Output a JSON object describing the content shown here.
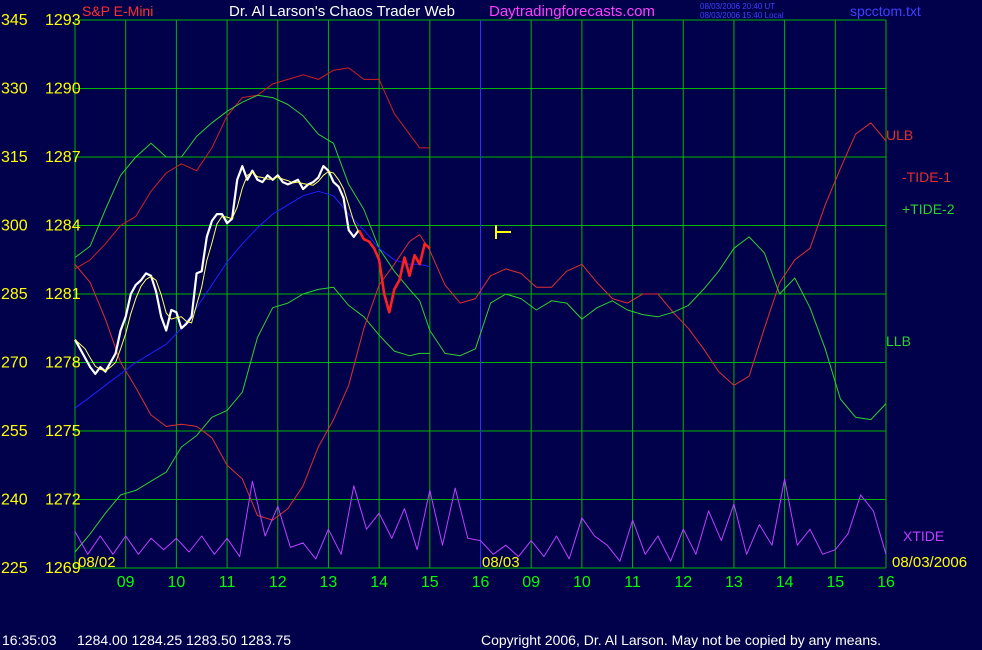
{
  "header": {
    "instrument": "S&P E-Mini",
    "title": "Dr. Al Larson's Chaos Trader Web",
    "site": "Daytradingforecasts.com",
    "timestamp_ut": "08/03/2006 20:40 UT",
    "timestamp_local": "08/03/2006 15:40 Local",
    "filename": "spcctom.txt"
  },
  "status_bar": {
    "time": "16:35:03",
    "quote": "1284.00 1284.25 1283.50 1283.75",
    "copyright": "Copyright 2006, Dr. Al Larson. May not be copied by any means."
  },
  "colors": {
    "background": "#00004b",
    "grid": "#00b400",
    "ulb": "#d22020",
    "tide1": "#e03030",
    "tide2": "#30d030",
    "xtide": "#c040ff",
    "blue": "#2020ff",
    "price": "#ffffff",
    "price_now": "#ff2020",
    "axis_left": "#ffff00",
    "axis_bottom": "#00ff00"
  },
  "chart_data": {
    "type": "line",
    "title": "S&P E-Mini",
    "y_left_labels": [
      "345",
      "330",
      "315",
      "300",
      "285",
      "270",
      "255",
      "240",
      "225"
    ],
    "y_price_labels": [
      "1293",
      "1290",
      "1287",
      "1284",
      "1281",
      "1278",
      "1275",
      "1272",
      "1269"
    ],
    "ylim": [
      1269,
      1293
    ],
    "x_hours_day1": [
      "09",
      "10",
      "11",
      "12",
      "13",
      "14",
      "15",
      "16"
    ],
    "x_hours_day2": [
      "09",
      "10",
      "11",
      "12",
      "13",
      "14",
      "15",
      "16"
    ],
    "x_grid_count": 16,
    "date_labels": [
      "08/02",
      "08/03",
      "08/03/2006"
    ],
    "grid": true,
    "legend_labels": {
      "ulb": "ULB",
      "tide1": "-TIDE-1",
      "tide2": "+TIDE-2",
      "llb": "LLB",
      "xtide": "XTIDE"
    },
    "series": [
      {
        "name": "ULB",
        "x": [
          0,
          0.3,
          0.6,
          0.9,
          1.2,
          1.5,
          1.8,
          2.1,
          2.4,
          2.7,
          3.0,
          3.3,
          3.6,
          3.9,
          4.2,
          4.5,
          4.8,
          5.1,
          5.4,
          5.7,
          6.0,
          6.3,
          6.6,
          6.8,
          7.0
        ],
        "y": [
          1282.1,
          1282.5,
          1283.2,
          1284.0,
          1284.4,
          1285.5,
          1286.3,
          1286.7,
          1286.4,
          1287.4,
          1288.8,
          1289.6,
          1289.7,
          1290.2,
          1290.4,
          1290.6,
          1290.4,
          1290.8,
          1290.9,
          1290.4,
          1290.4,
          1288.9,
          1288.0,
          1287.4,
          1287.4
        ]
      },
      {
        "name": "LLB",
        "x": [
          0,
          0.3,
          0.6,
          0.9,
          1.2,
          1.5,
          1.8,
          2.1,
          2.4,
          2.7,
          3.0,
          3.3,
          3.6,
          3.9,
          4.2,
          4.5,
          4.8,
          5.1,
          5.4,
          5.7,
          6.0,
          6.3,
          6.6,
          6.8,
          7.0
        ],
        "y": [
          1269.7,
          1270.5,
          1271.4,
          1272.2,
          1272.4,
          1272.8,
          1273.2,
          1274.3,
          1274.8,
          1275.6,
          1275.9,
          1276.7,
          1279.1,
          1280.4,
          1280.6,
          1281.0,
          1281.2,
          1281.3,
          1280.5,
          1280.0,
          1279.2,
          1278.5,
          1278.3,
          1278.4,
          1278.4
        ]
      },
      {
        "name": "-TIDE-1",
        "x": [
          0,
          0.3,
          0.6,
          0.9,
          1.2,
          1.5,
          1.8,
          2.1,
          2.4,
          2.7,
          3.0,
          3.3,
          3.6,
          3.9,
          4.2,
          4.5,
          4.8,
          5.1,
          5.4,
          5.7,
          6.0,
          6.3,
          6.6,
          6.8,
          7.0,
          7.3,
          7.6,
          7.9,
          8.2,
          8.5,
          8.8,
          9.1,
          9.4,
          9.7,
          10.0,
          10.3,
          10.6,
          10.9,
          11.2,
          11.5,
          11.8,
          12.1,
          12.4,
          12.7,
          13.0,
          13.3,
          13.6,
          13.9,
          14.2,
          14.5,
          14.8,
          15.1,
          15.4,
          15.7,
          16.0
        ],
        "y": [
          1282.3,
          1281.5,
          1279.9,
          1278.0,
          1276.9,
          1275.7,
          1275.2,
          1275.3,
          1275.2,
          1274.7,
          1273.5,
          1272.9,
          1271.3,
          1271.1,
          1271.6,
          1272.6,
          1274.3,
          1275.5,
          1277.0,
          1279.5,
          1281.4,
          1282.3,
          1283.3,
          1283.6,
          1282.9,
          1281.4,
          1280.6,
          1280.8,
          1281.8,
          1282.1,
          1281.9,
          1281.3,
          1281.3,
          1282.0,
          1282.3,
          1281.5,
          1280.8,
          1280.6,
          1281.0,
          1281.0,
          1280.2,
          1279.5,
          1278.6,
          1277.6,
          1277.0,
          1277.4,
          1279.5,
          1281.5,
          1282.5,
          1283.0,
          1284.9,
          1286.5,
          1288.0,
          1288.5,
          1287.7
        ]
      },
      {
        "name": "+TIDE-2",
        "x": [
          0,
          0.3,
          0.6,
          0.9,
          1.2,
          1.5,
          1.8,
          2.1,
          2.4,
          2.7,
          3.0,
          3.3,
          3.6,
          3.9,
          4.2,
          4.5,
          4.8,
          5.1,
          5.4,
          5.7,
          6.0,
          6.3,
          6.6,
          6.8,
          7.0,
          7.3,
          7.6,
          7.9,
          8.2,
          8.5,
          8.8,
          9.1,
          9.4,
          9.7,
          10.0,
          10.3,
          10.6,
          10.9,
          11.2,
          11.5,
          11.8,
          12.1,
          12.4,
          12.7,
          13.0,
          13.3,
          13.6,
          13.9,
          14.2,
          14.5,
          14.8,
          15.1,
          15.4,
          15.7,
          16.0
        ],
        "y": [
          1282.6,
          1283.1,
          1284.7,
          1286.2,
          1287.0,
          1287.6,
          1287.0,
          1287.0,
          1287.9,
          1288.5,
          1289.0,
          1289.4,
          1289.7,
          1289.6,
          1289.3,
          1288.8,
          1288.0,
          1287.6,
          1285.8,
          1284.7,
          1283.0,
          1282.0,
          1281.2,
          1280.7,
          1279.4,
          1278.4,
          1278.3,
          1278.6,
          1280.6,
          1281.0,
          1280.8,
          1280.3,
          1280.7,
          1280.6,
          1279.9,
          1280.4,
          1280.7,
          1280.3,
          1280.1,
          1280.0,
          1280.2,
          1280.5,
          1281.2,
          1282.0,
          1283.0,
          1283.5,
          1282.8,
          1281.0,
          1281.7,
          1280.4,
          1278.6,
          1276.4,
          1275.6,
          1275.5,
          1276.2
        ]
      },
      {
        "name": "blue",
        "x": [
          0,
          0.3,
          0.6,
          0.9,
          1.2,
          1.5,
          1.8,
          2.1,
          2.4,
          2.7,
          3.0,
          3.3,
          3.6,
          3.9,
          4.2,
          4.5,
          4.8,
          5.1,
          5.4,
          5.7,
          6.0,
          6.3,
          6.6,
          6.8,
          7.0
        ],
        "y": [
          1276.0,
          1276.5,
          1277.0,
          1277.5,
          1278.0,
          1278.4,
          1278.8,
          1279.5,
          1280.4,
          1281.4,
          1282.4,
          1283.2,
          1283.9,
          1284.5,
          1284.9,
          1285.3,
          1285.5,
          1285.3,
          1284.5,
          1283.8,
          1283.0,
          1282.5,
          1282.3,
          1282.3,
          1282.2
        ]
      },
      {
        "name": "price",
        "x": [
          0,
          0.1,
          0.2,
          0.3,
          0.4,
          0.5,
          0.6,
          0.7,
          0.8,
          0.9,
          1.0,
          1.1,
          1.2,
          1.3,
          1.4,
          1.5,
          1.6,
          1.7,
          1.8,
          1.9,
          2.0,
          2.1,
          2.2,
          2.3,
          2.4,
          2.5,
          2.6,
          2.7,
          2.8,
          2.9,
          3.0,
          3.1,
          3.2,
          3.3,
          3.4,
          3.5,
          3.6,
          3.7,
          3.8,
          3.9,
          4.0,
          4.1,
          4.2,
          4.3,
          4.4,
          4.5,
          4.6,
          4.7,
          4.8,
          4.9,
          5.0,
          5.1,
          5.2,
          5.3,
          5.4,
          5.5,
          5.6
        ],
        "y": [
          1279.0,
          1278.6,
          1278.2,
          1277.8,
          1277.5,
          1277.8,
          1277.6,
          1278.0,
          1278.4,
          1279.4,
          1280.0,
          1281.0,
          1281.4,
          1281.6,
          1281.9,
          1281.8,
          1281.1,
          1280.0,
          1279.4,
          1280.3,
          1280.2,
          1279.5,
          1279.7,
          1280.0,
          1281.9,
          1282.0,
          1283.5,
          1284.2,
          1284.5,
          1284.5,
          1284.1,
          1284.3,
          1286.0,
          1286.6,
          1286.0,
          1286.4,
          1286.0,
          1285.9,
          1286.2,
          1286.0,
          1286.2,
          1285.9,
          1285.8,
          1285.9,
          1286.0,
          1285.6,
          1285.8,
          1285.9,
          1286.1,
          1286.6,
          1286.4,
          1285.9,
          1285.7,
          1285.2,
          1283.8,
          1283.5,
          1283.8
        ]
      },
      {
        "name": "price_now",
        "x": [
          5.6,
          5.7,
          5.8,
          5.9,
          6.0,
          6.1,
          6.2,
          6.3,
          6.4,
          6.5,
          6.6,
          6.7,
          6.8,
          6.9,
          7.0
        ],
        "y": [
          1283.8,
          1283.4,
          1283.3,
          1283.0,
          1282.5,
          1281.0,
          1280.2,
          1281.2,
          1281.6,
          1282.6,
          1281.8,
          1282.7,
          1282.3,
          1283.2,
          1283.0
        ]
      },
      {
        "name": "XTIDE",
        "x": [
          0,
          0.25,
          0.5,
          0.75,
          1.0,
          1.25,
          1.5,
          1.75,
          2.0,
          2.25,
          2.5,
          2.75,
          3.0,
          3.25,
          3.5,
          3.75,
          4.0,
          4.25,
          4.5,
          4.75,
          5.0,
          5.25,
          5.5,
          5.75,
          6.0,
          6.25,
          6.5,
          6.75,
          7.0,
          7.25,
          7.5,
          7.75,
          8.0,
          8.25,
          8.5,
          8.75,
          9.0,
          9.25,
          9.5,
          9.75,
          10.0,
          10.25,
          10.5,
          10.75,
          11.0,
          11.25,
          11.5,
          11.75,
          12.0,
          12.25,
          12.5,
          12.75,
          13.0,
          13.25,
          13.5,
          13.75,
          14.0,
          14.25,
          14.5,
          14.75,
          15.0,
          15.25,
          15.5,
          15.75,
          16.0
        ],
        "y": [
          1270.6,
          1269.6,
          1270.4,
          1269.6,
          1270.4,
          1269.6,
          1270.3,
          1269.8,
          1270.3,
          1269.7,
          1270.4,
          1269.6,
          1270.3,
          1269.5,
          1272.8,
          1270.4,
          1271.7,
          1269.9,
          1270.1,
          1269.4,
          1270.7,
          1269.6,
          1272.6,
          1270.7,
          1271.4,
          1270.3,
          1271.6,
          1269.8,
          1272.4,
          1270.0,
          1272.5,
          1270.3,
          1270.2,
          1269.6,
          1270.0,
          1269.5,
          1270.2,
          1269.5,
          1270.4,
          1269.4,
          1271.2,
          1270.4,
          1270.0,
          1269.3,
          1271.1,
          1269.6,
          1270.4,
          1269.3,
          1270.7,
          1269.6,
          1271.5,
          1270.2,
          1271.8,
          1269.6,
          1270.9,
          1270.0,
          1272.9,
          1270.0,
          1270.7,
          1269.6,
          1269.8,
          1270.5,
          1272.2,
          1271.5,
          1269.6
        ]
      }
    ]
  }
}
